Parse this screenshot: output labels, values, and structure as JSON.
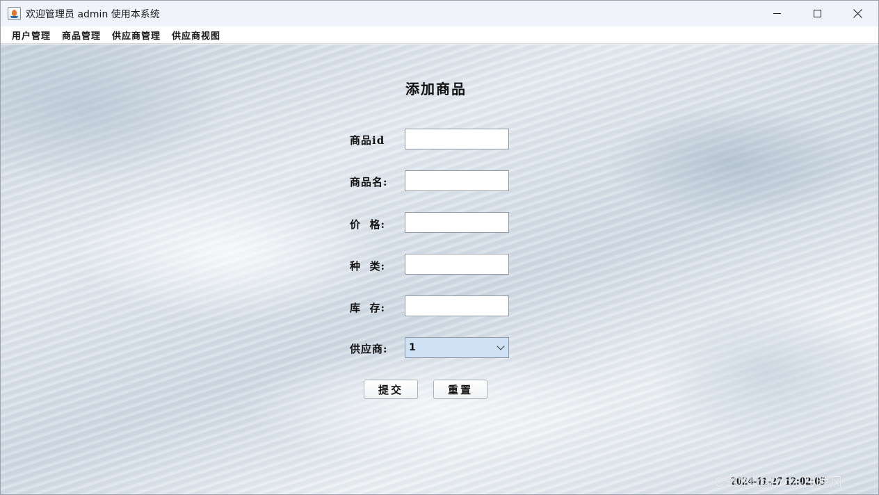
{
  "window": {
    "title": "欢迎管理员 admin 使用本系统",
    "icon": "java-cup-icon"
  },
  "menubar": {
    "items": [
      {
        "label": "用户管理"
      },
      {
        "label": "商品管理"
      },
      {
        "label": "供应商管理"
      },
      {
        "label": "供应商视图"
      }
    ]
  },
  "form": {
    "title": "添加商品",
    "fields": {
      "id": {
        "label": "商品id",
        "value": ""
      },
      "name": {
        "label": "商品名:",
        "value": ""
      },
      "price": {
        "label": "价  格:",
        "value": ""
      },
      "category": {
        "label": "种  类:",
        "value": ""
      },
      "stock": {
        "label": "库  存:",
        "value": ""
      },
      "supplier": {
        "label": "供应商:",
        "selected": "1"
      }
    },
    "buttons": {
      "submit": "提交",
      "reset": "重置"
    }
  },
  "status": {
    "datetime": "2024-11-27 12:02:05"
  },
  "watermark": "CSDN @Frcz-日晚风",
  "colors": {
    "select_bg": "#cfe2f6",
    "titlebar_bg": "#f0f3f9"
  }
}
